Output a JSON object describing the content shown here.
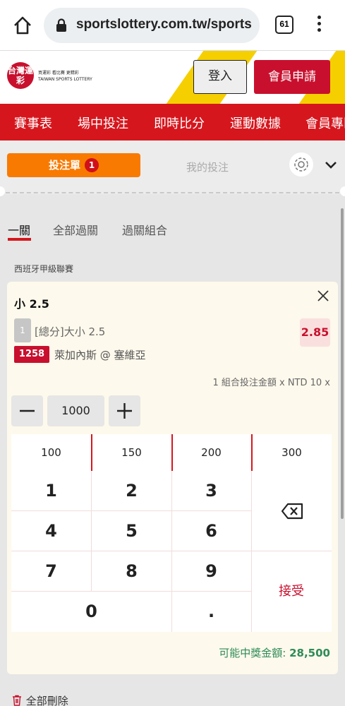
{
  "browser": {
    "url": "sportslottery.com.tw/sports",
    "tab_count": "61"
  },
  "site": {
    "logo_text": "台灣運彩",
    "logo_caption_line1": "買運彩 看比賽 更精彩",
    "logo_caption_line2": "TAIWAN SPORTS LOTTERY",
    "login_label": "登入",
    "register_label": "會員申請"
  },
  "nav": {
    "items": [
      "賽事表",
      "場中投注",
      "即時比分",
      "運動數據",
      "會員專區"
    ]
  },
  "panel": {
    "betslip_label": "投注單",
    "betslip_count": "1",
    "mybets_label": "我的投注"
  },
  "bet_tabs": [
    "一關",
    "全部過關",
    "過關組合"
  ],
  "league": "西班牙甲級聯賽",
  "bet": {
    "selection": "小 2.5",
    "index": "1",
    "market": "[總分]大小 2.5",
    "odds": "2.85",
    "match_id": "1258",
    "match": "萊加內斯 @ 塞維亞",
    "stake_info": "1 組合投注金額 x NTD 10 x",
    "amount": "1000",
    "quick_amounts": [
      "100",
      "150",
      "200",
      "300"
    ],
    "keys": [
      "1",
      "2",
      "3",
      "4",
      "5",
      "6",
      "7",
      "8",
      "9",
      "0",
      "."
    ],
    "accept_label": "接受",
    "payout_label": "可能中獎金額:",
    "payout_value": "28,500"
  },
  "footer": {
    "delete_all": "全部刪除"
  },
  "colors": {
    "brand_red": "#d6161d",
    "orange": "#f97a00",
    "yellow": "#f5cf00",
    "payout_green": "#2e8b57"
  }
}
